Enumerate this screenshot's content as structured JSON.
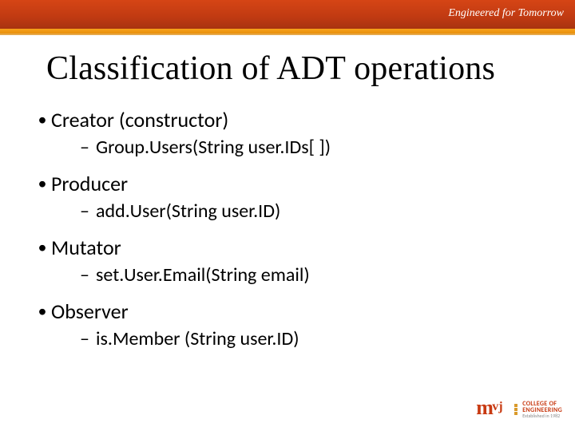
{
  "header": {
    "tagline": "Engineered for Tomorrow"
  },
  "title": "Classification of ADT operations",
  "items": [
    {
      "label": "Creator (constructor)",
      "sub": "Group.Users(String user.IDs[ ])"
    },
    {
      "label": "Producer",
      "sub": "add.User(String user.ID)"
    },
    {
      "label": "Mutator",
      "sub": "set.User.Email(String email)"
    },
    {
      "label": "Observer",
      "sub": "is.Member (String user.ID)"
    }
  ],
  "logo": {
    "mark": "mvj",
    "line1": "COLLEGE OF",
    "line2": "ENGINEERING",
    "line3": "Established in 1982"
  }
}
